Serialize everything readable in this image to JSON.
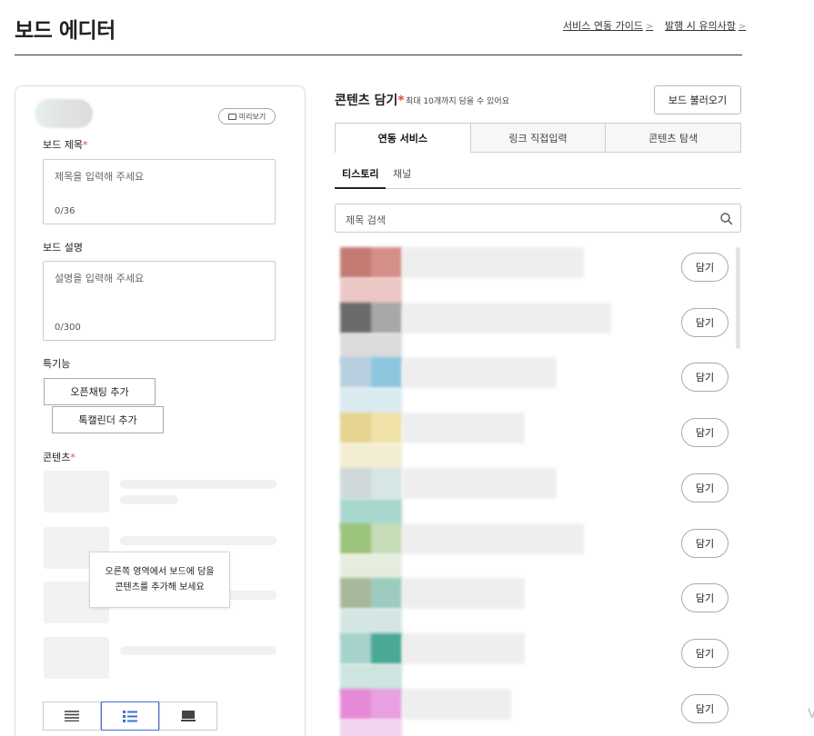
{
  "header": {
    "title": "보드 에디터",
    "links": [
      {
        "label": "서비스 연동 가이드"
      },
      {
        "label": "발행 시 유의사항"
      }
    ]
  },
  "editor": {
    "preview_label": "미리보기",
    "board_title": {
      "label": "보드 제목",
      "required_mark": "*",
      "placeholder": "제목을 입력해 주세요",
      "count": "0/36"
    },
    "board_desc": {
      "label": "보드 설명",
      "placeholder": "설명을 입력해 주세요",
      "count": "0/300"
    },
    "special": {
      "label": "특기능",
      "buttons": [
        "오픈채팅 추가",
        "톡캘린더 추가"
      ]
    },
    "contents": {
      "label": "콘텐츠",
      "required_mark": "*"
    },
    "tooltip": {
      "line1": "오른쪽 영역에서 보드에 담을",
      "line2": "콘텐츠를 추가해 보세요"
    },
    "view_modes": [
      "list-compact-icon",
      "list-detail-icon",
      "card-icon"
    ]
  },
  "picker": {
    "title": "콘텐츠 담기",
    "required_mark": "*",
    "note": "최대 10개까지 담을 수 있어요",
    "load_button": "보드 불러오기",
    "tabs": [
      "연동 서비스",
      "링크 직접입력",
      "콘텐츠 탐색"
    ],
    "subtabs": [
      "티스토리",
      "채널"
    ],
    "search_placeholder": "제목 검색",
    "add_label": "담기",
    "item_colors": [
      [
        "#c47a72",
        "#d49088",
        "#e8c2be"
      ],
      [
        "#6b6b6b",
        "#a8a8a8",
        "#d8d8d8"
      ],
      [
        "#b8cfe0",
        "#8ec6e0",
        "#d6e8f0"
      ],
      [
        "#e6d38f",
        "#f0e2a8",
        "#f2ecd0"
      ],
      [
        "#cfd8d8",
        "#d6e6e6",
        "#9fd4c8"
      ],
      [
        "#9cc47c",
        "#c6dcb8",
        "#e4ecdc"
      ],
      [
        "#a6b89a",
        "#9ccbbf",
        "#d0e4e0"
      ],
      [
        "#a6d2cc",
        "#4aa894",
        "#c8e2dc"
      ],
      [
        "#e68ad8",
        "#e9a0e0",
        "#f0d0ec"
      ]
    ]
  }
}
